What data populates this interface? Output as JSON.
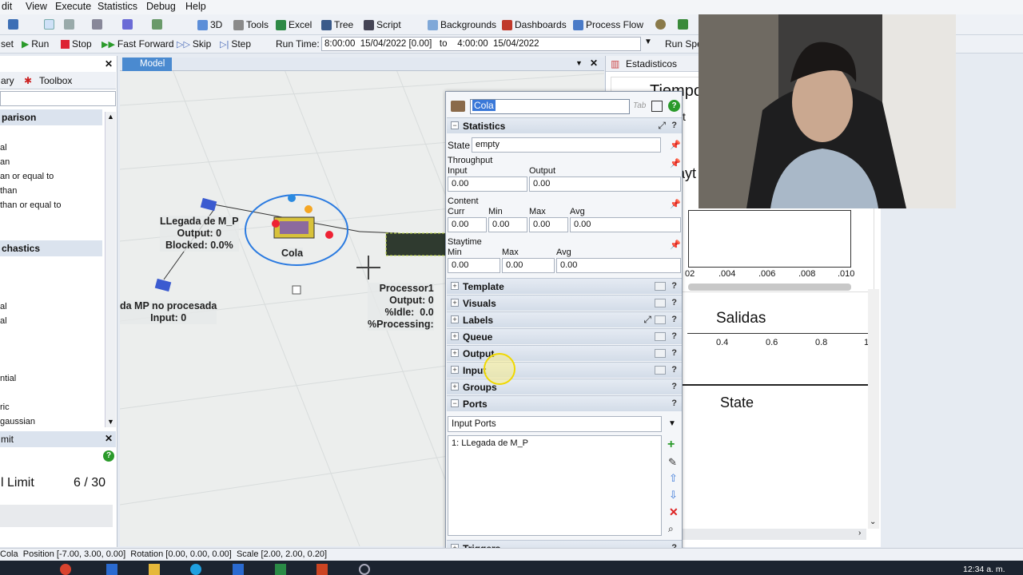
{
  "menu": [
    "dit",
    "View",
    "Execute",
    "Statistics",
    "Debug",
    "Help"
  ],
  "toolbar": {
    "3d": "3D",
    "tools": "Tools",
    "excel": "Excel",
    "tree": "Tree",
    "script": "Script",
    "backgrounds": "Backgrounds",
    "dashboards": "Dashboards",
    "process_flow": "Process Flow"
  },
  "runbar": {
    "reset": "set",
    "run": "Run",
    "stop": "Stop",
    "fast_forward": "Fast Forward",
    "skip": "Skip",
    "step": "Step",
    "run_time_label": "Run Time:",
    "run_time_value": "8:00:00  15/04/2022 [0.00]   to    4:00:00  15/04/2022",
    "run_speed": "Run Spee"
  },
  "left": {
    "tab_library": "ary",
    "tab_toolbox": "Toolbox",
    "section1": "parison",
    "items1": [
      "al",
      "an",
      "an or equal to",
      "than",
      "than or equal to"
    ],
    "section2": "chastics",
    "items2": [
      "al",
      "al",
      "ntial",
      "ric",
      "gaussian"
    ],
    "panel_title": "mit",
    "limit_label": "l Limit",
    "limit_value": "6 / 30"
  },
  "model": {
    "tab": "Model",
    "labels": {
      "source": "LLegada de M_P\nOutput: 0\nBlocked: 0.0%",
      "queue": "Cola",
      "sink": "da MP no procesada\nInput: 0",
      "processor": "Processor1\nOutput: 0\n%Idle:  0.0\n%Processing:"
    }
  },
  "props": {
    "name": "Cola",
    "tab_hint": "Tab",
    "statistics": {
      "title": "Statistics",
      "state_label": "State",
      "state": "empty",
      "throughput": "Throughput",
      "input_label": "Input",
      "output_label": "Output",
      "input": "0.00",
      "output": "0.00",
      "content": "Content",
      "curr_label": "Curr",
      "min_label": "Min",
      "max_label": "Max",
      "avg_label": "Avg",
      "curr": "0.00",
      "min": "0.00",
      "max": "0.00",
      "avg": "0.00",
      "staytime": "Staytime",
      "st_min": "0.00",
      "st_max": "0.00",
      "st_avg": "0.00"
    },
    "sections": [
      "Template",
      "Visuals",
      "Labels",
      "Queue",
      "Output",
      "Input",
      "Groups",
      "Ports"
    ],
    "ports": {
      "dropdown": "Input Ports",
      "entry": "1:  LLegada de M_P"
    },
    "triggers": "Triggers"
  },
  "right": {
    "tab": "Estadisticos",
    "title_partial": "Tiempo",
    "ticks_top": [
      "02",
      ".004",
      ".006",
      ".008",
      ".010"
    ],
    "salidas": "Salidas",
    "ticks_bottom": [
      "0.4",
      "0.6",
      "0.8",
      "1"
    ],
    "state": "State",
    "partial1": "ct",
    "partial2": "ayt"
  },
  "status": "Cola  Position [-7.00, 3.00, 0.00]  Rotation [0.00, 0.00, 0.00]  Scale [2.00, 2.00, 0.20]",
  "clock": "12:34 a. m."
}
